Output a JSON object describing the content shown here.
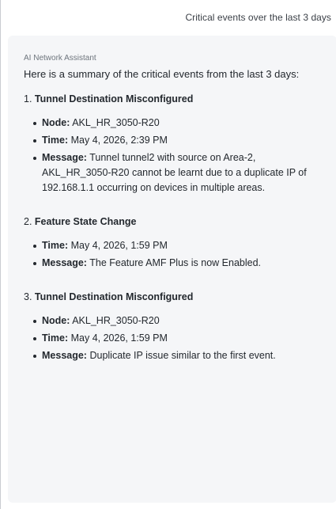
{
  "user_message": "Critical events over the last 3 days",
  "assistant": {
    "sender": "AI Network Assistant",
    "intro": "Here is a summary of the critical events from the last 3 days:",
    "events": [
      {
        "number": "1.",
        "title": "Tunnel Destination Misconfigured",
        "details": [
          {
            "label": "Node:",
            "value": "AKL_HR_3050-R20"
          },
          {
            "label": "Time:",
            "value": "May 4, 2026, 2:39 PM"
          },
          {
            "label": "Message:",
            "value": "Tunnel tunnel2 with source on Area-2, AKL_HR_3050-R20 cannot be learnt due to a duplicate IP of 192.168.1.1 occurring on devices in multiple areas."
          }
        ]
      },
      {
        "number": "2.",
        "title": "Feature State Change",
        "details": [
          {
            "label": "Time:",
            "value": "May 4, 2026, 1:59 PM"
          },
          {
            "label": "Message:",
            "value": "The Feature AMF Plus is now Enabled."
          }
        ]
      },
      {
        "number": "3.",
        "title": "Tunnel Destination Misconfigured",
        "details": [
          {
            "label": "Node:",
            "value": "AKL_HR_3050-R20"
          },
          {
            "label": "Time:",
            "value": "May 4, 2026, 1:59 PM"
          },
          {
            "label": "Message:",
            "value": "Duplicate IP issue similar to the first event."
          }
        ]
      }
    ]
  }
}
